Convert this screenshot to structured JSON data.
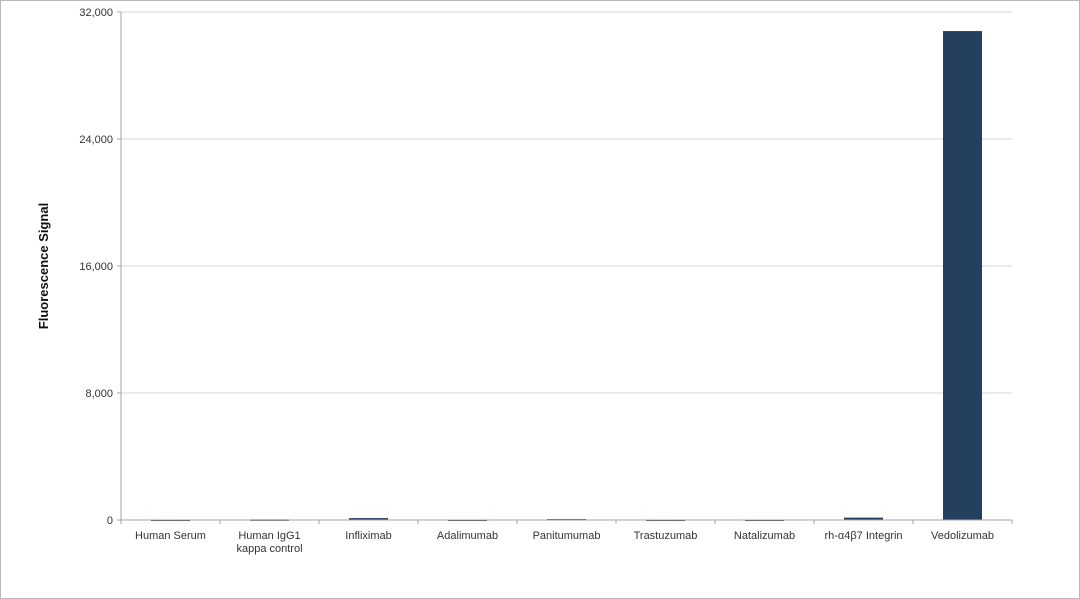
{
  "chart_data": {
    "type": "bar",
    "ylabel": "Fluorescence Signal",
    "xlabel": "",
    "ylim": [
      0,
      32000
    ],
    "yticks": [
      0,
      8000,
      16000,
      24000,
      32000
    ],
    "ytick_labels": [
      "0",
      "8,000",
      "16,000",
      "24,000",
      "32,000"
    ],
    "grid": true,
    "categories": [
      [
        "Human Serum"
      ],
      [
        "Human IgG1",
        "kappa control"
      ],
      [
        "Infliximab"
      ],
      [
        "Adalimumab"
      ],
      [
        "Panitumumab"
      ],
      [
        "Trastuzumab"
      ],
      [
        "Natalizumab"
      ],
      [
        "rh-α4β7 Integrin"
      ],
      [
        "Vedolizumab"
      ]
    ],
    "values": [
      30,
      40,
      120,
      30,
      60,
      30,
      30,
      150,
      30800
    ],
    "colors": {
      "bar": "#253f5e",
      "grid": "#d4d4d4",
      "axis": "#a6a6a6"
    }
  }
}
